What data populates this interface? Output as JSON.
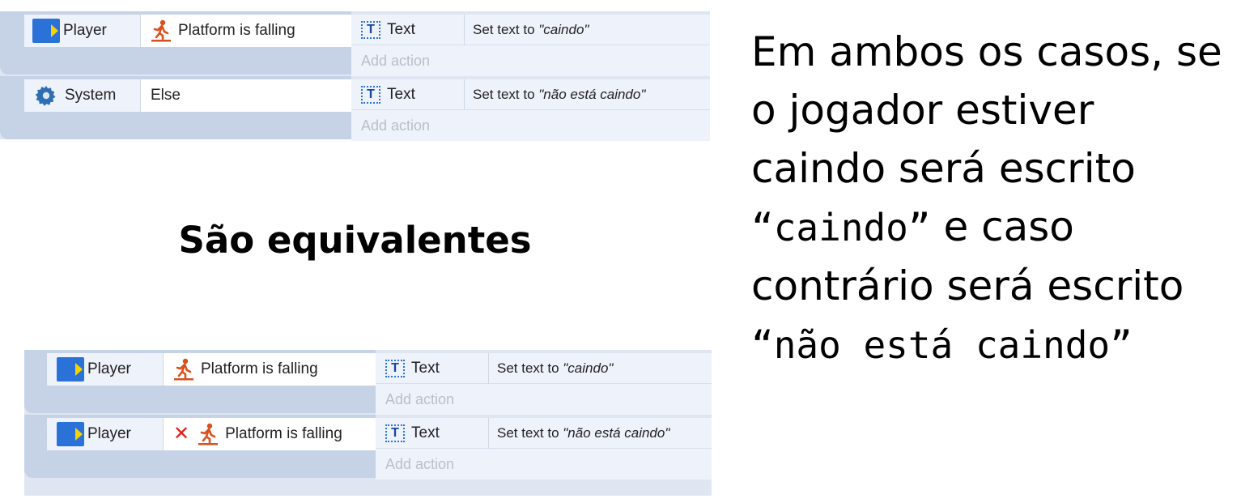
{
  "top_block": {
    "events": [
      {
        "condition_object": "Player",
        "condition_object_icon": "player-sprite-icon",
        "condition_text": "Platform is falling",
        "condition_icon": "falling-person-icon",
        "action_object": "Text",
        "action_object_icon": "text-object-icon",
        "action_prefix": "Set text to ",
        "action_value": "\"caindo\"",
        "add_action_label": "Add action"
      },
      {
        "condition_object": "System",
        "condition_object_icon": "gear-icon",
        "condition_text": "Else",
        "action_object": "Text",
        "action_object_icon": "text-object-icon",
        "action_prefix": "Set text to ",
        "action_value": "\"não está caindo\"",
        "add_action_label": "Add action"
      }
    ]
  },
  "heading": "São equivalentes",
  "bottom_block": {
    "events": [
      {
        "condition_object": "Player",
        "condition_object_icon": "player-sprite-icon",
        "condition_text": "Platform is falling",
        "condition_icon": "falling-person-icon",
        "inverted": false,
        "action_object": "Text",
        "action_object_icon": "text-object-icon",
        "action_prefix": "Set text to ",
        "action_value": "\"caindo\"",
        "add_action_label": "Add action"
      },
      {
        "condition_object": "Player",
        "condition_object_icon": "player-sprite-icon",
        "condition_text": "Platform is falling",
        "condition_icon": "falling-person-icon",
        "inverted": true,
        "invert_icon": "red-x-icon",
        "action_object": "Text",
        "action_object_icon": "text-object-icon",
        "action_prefix": "Set text to ",
        "action_value": "\"não está caindo\"",
        "add_action_label": "Add action"
      }
    ]
  },
  "explanation": {
    "part1": "Em ambos os casos, se o jogador estiver caindo será escrito ",
    "quote1": "“caindo”",
    "part2": " e caso contrário será escrito ",
    "quote2": "“não está caindo”"
  },
  "colors": {
    "accent_blue": "#2a72d8",
    "sprite_arrow_yellow": "#f5d400",
    "invert_red": "#e02020",
    "falling_icon_orange": "#d8501c",
    "add_action_gray": "#b8c0cc"
  }
}
